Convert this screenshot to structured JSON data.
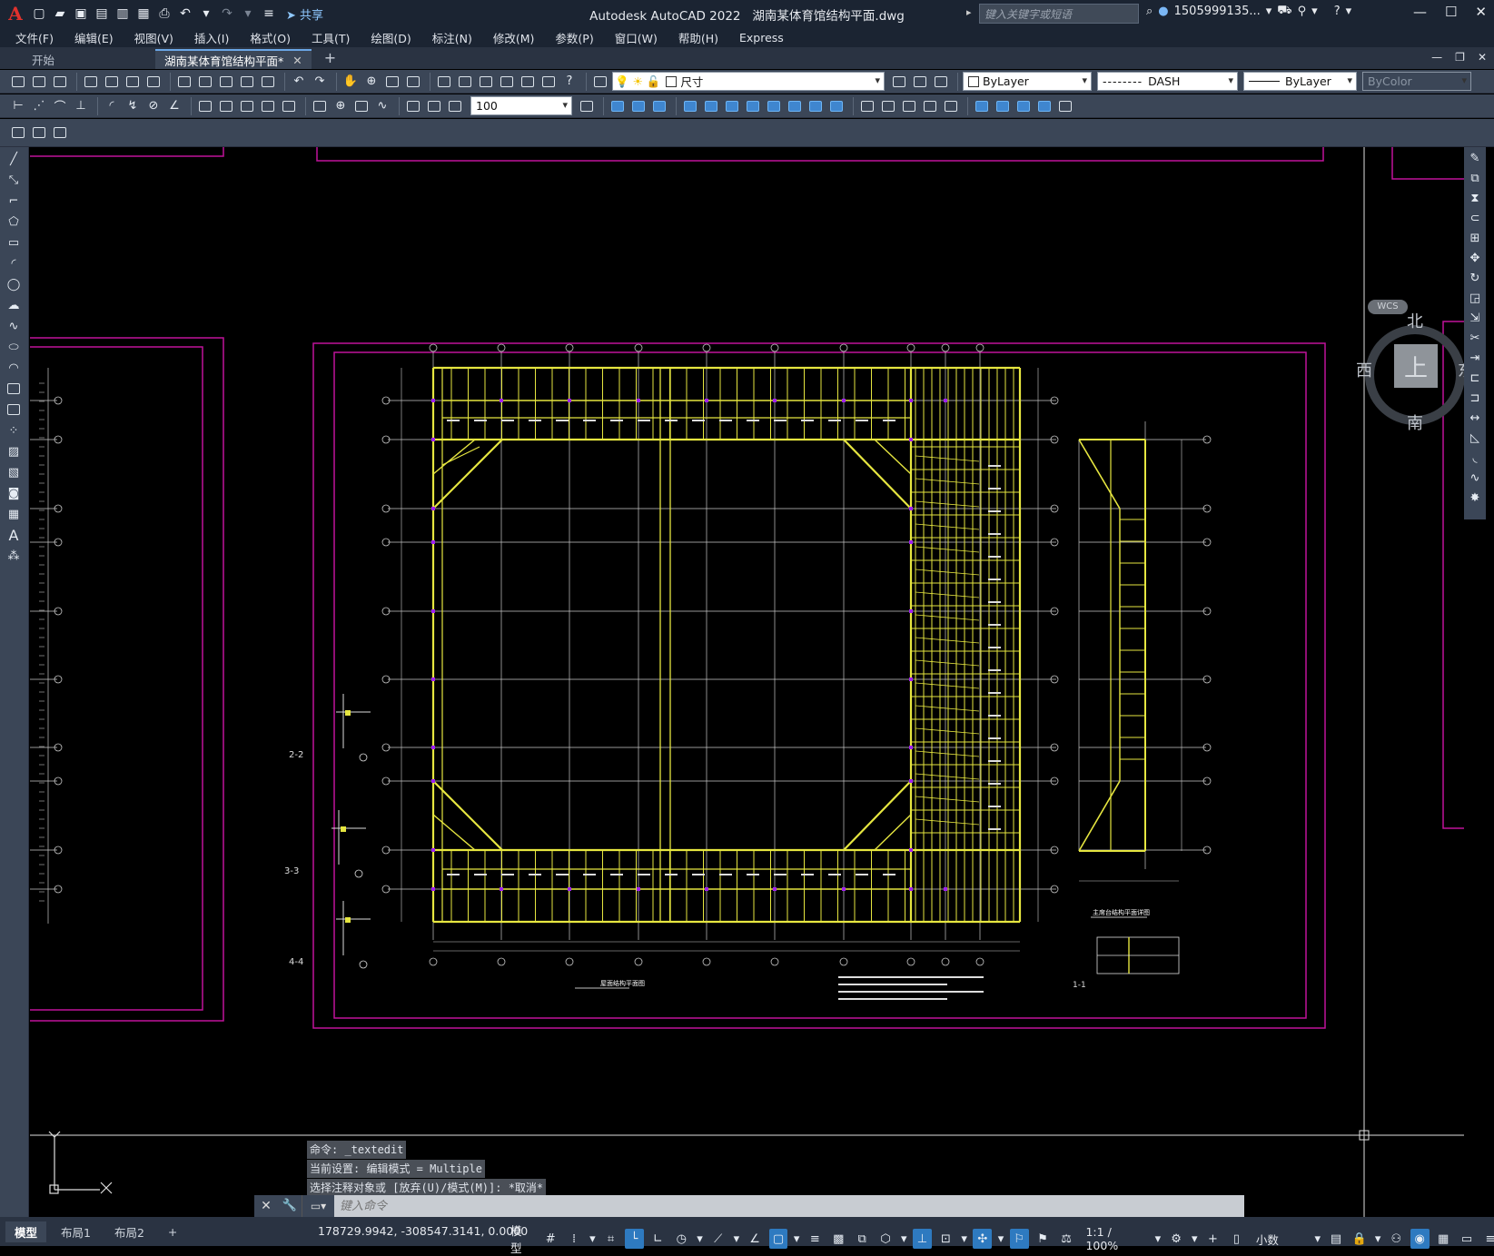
{
  "app": {
    "title": "Autodesk AutoCAD 2022",
    "document": "湖南某体育馆结构平面.dwg",
    "share": "共享",
    "search_placeholder": "键入关键字或短语",
    "user": "1505999135...",
    "logo": "A"
  },
  "menu": [
    "文件(F)",
    "编辑(E)",
    "视图(V)",
    "插入(I)",
    "格式(O)",
    "工具(T)",
    "绘图(D)",
    "标注(N)",
    "修改(M)",
    "参数(P)",
    "窗口(W)",
    "帮助(H)",
    "Express"
  ],
  "tabs": [
    {
      "label": "开始",
      "active": false
    },
    {
      "label": "湖南某体育馆结构平面*",
      "active": true
    }
  ],
  "layer_combo": "尺寸",
  "props": {
    "color": "ByLayer",
    "linetype": "DASH",
    "lineweight": "ByLayer",
    "plotstyle": "ByColor"
  },
  "dim_scale": "100",
  "viewcube": {
    "north": "北",
    "south": "南",
    "east": "东",
    "west": "西",
    "face": "上",
    "wcs": "WCS"
  },
  "command_history": [
    "命令: _textedit",
    "当前设置: 编辑模式 = Multiple",
    "选择注释对象或 [放弃(U)/模式(M)]: *取消*"
  ],
  "command_placeholder": "键入命令",
  "status": {
    "tabs": [
      "模型",
      "布局1",
      "布局2"
    ],
    "coords": "178729.9942, -308547.3141, 0.0000",
    "model": "模型",
    "scale": "1:1 / 100%",
    "units": "小数"
  },
  "drawing": {
    "grid_numbers_top": [
      "①",
      "②",
      "③",
      "④",
      "⑤",
      "⑥",
      "⑦",
      "⑧",
      "⑨",
      "⑩",
      "⑪"
    ],
    "grid_letters_side": [
      "Ⓚ",
      "Ⓙ",
      "Ⓗ",
      "Ⓖ",
      "Ⓕ",
      "Ⓔ",
      "Ⓓ",
      "Ⓒ",
      "Ⓑ",
      "Ⓐ"
    ],
    "sec_labels": [
      "2-2",
      "3-3",
      "4-4",
      "1-1"
    ],
    "plan_title": "屋面结构平面图",
    "elev_title": "主席台结构平面详图"
  },
  "colors": {
    "beam": "#e6e640",
    "frame": "#c0129a",
    "grid": "#c8c8c8",
    "marker": "#a020f0"
  }
}
